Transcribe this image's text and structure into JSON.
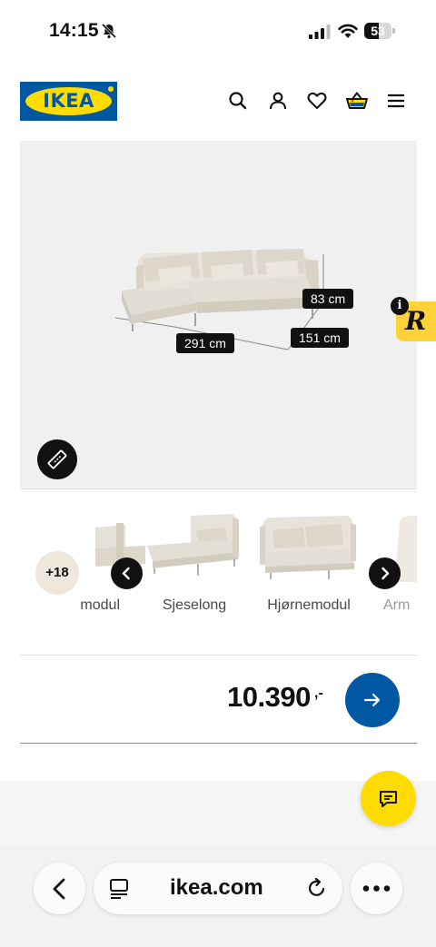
{
  "status_bar": {
    "time": "14:15",
    "battery_level": "53",
    "battery_fraction": 0.53,
    "icons": [
      "bell-slash-icon",
      "cellular-signal-icon",
      "wifi-icon",
      "battery-icon"
    ]
  },
  "header": {
    "logo_text": "IKEA",
    "brand_colors": {
      "blue": "#0058a3",
      "yellow": "#ffdb00"
    },
    "icons": [
      "search-icon",
      "account-icon",
      "favorites-heart-icon",
      "shopping-basket-icon",
      "menu-icon"
    ]
  },
  "product_image": {
    "dimensions": {
      "width": "291 cm",
      "depth": "151 cm",
      "height": "83 cm"
    },
    "measure_icon": "ruler-icon"
  },
  "extension": {
    "info_glyph": "i",
    "mark": "R"
  },
  "variants": {
    "more_count": "+18",
    "items": [
      {
        "label": "modul"
      },
      {
        "label": "Sjeselong"
      },
      {
        "label": "Hjørnemodul"
      },
      {
        "label": "Arm"
      }
    ]
  },
  "price": {
    "amount": "10.390",
    "suffix": ",-"
  },
  "browser": {
    "url": "ikea.com",
    "icons": [
      "back-chevron-icon",
      "tabs-icon",
      "reload-icon",
      "more-dots-icon"
    ]
  },
  "colors": {
    "accent_blue": "#0058a3",
    "chat_yellow": "#ffdb00",
    "extension_yellow": "#ffd23a"
  }
}
